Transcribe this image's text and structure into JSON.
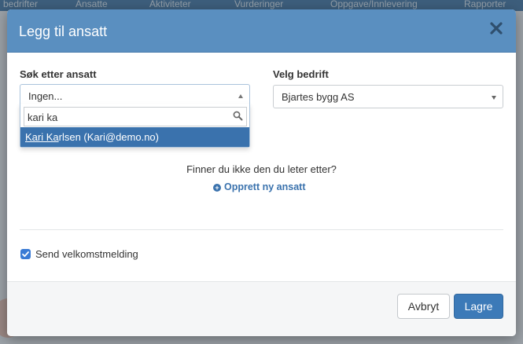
{
  "background_nav": {
    "items": [
      "bedrifter",
      "Ansatte",
      "Aktiviteter",
      "Vurderinger",
      "Oppgave/Innlevering",
      "Rapporter"
    ]
  },
  "modal": {
    "title": "Legg til ansatt",
    "close_icon": "close-icon"
  },
  "employee_search": {
    "label": "Søk etter ansatt",
    "selected_value": "Ingen...",
    "search_text": "kari ka",
    "search_icon": "search-icon",
    "result": {
      "match": "Kari Ka",
      "rest": "rlsen (Kari@demo.no)"
    }
  },
  "company_select": {
    "label": "Velg bedrift",
    "selected_value": "Bjartes bygg AS"
  },
  "not_found": {
    "text": "Finner du ikke den du leter etter?",
    "create_link": "Opprett ny ansatt"
  },
  "welcome": {
    "label": "Send velkomstmelding",
    "checked": true
  },
  "footer": {
    "cancel_label": "Avbryt",
    "save_label": "Lagre"
  },
  "colors": {
    "header": "#5a8fc0",
    "primary": "#3c7ab8",
    "highlight": "#3a72ad"
  }
}
